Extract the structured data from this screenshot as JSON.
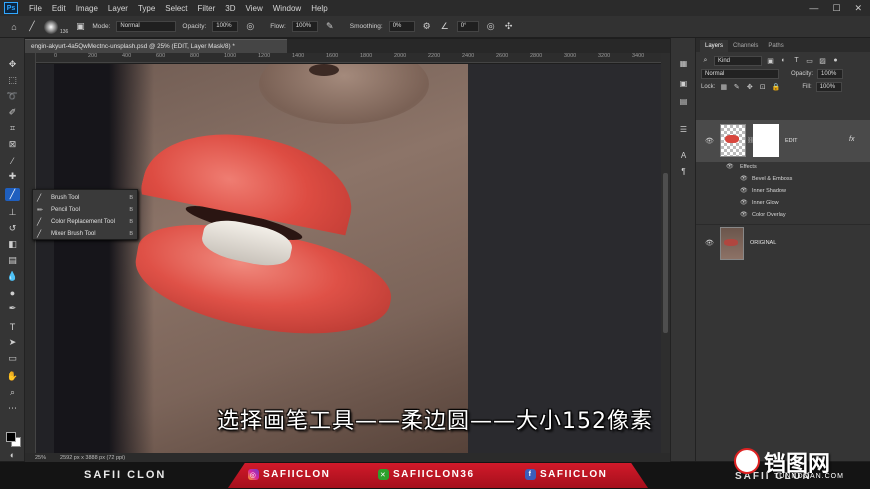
{
  "menubar": {
    "logo": "Ps",
    "items": [
      "File",
      "Edit",
      "Image",
      "Layer",
      "Type",
      "Select",
      "Filter",
      "3D",
      "View",
      "Window",
      "Help"
    ],
    "window_controls": [
      "—",
      "☐",
      "✕"
    ]
  },
  "options": {
    "brush_size": "136",
    "mode_label": "Mode:",
    "mode_value": "Normal",
    "opacity_label": "Opacity:",
    "opacity_value": "100%",
    "flow_label": "Flow:",
    "flow_value": "100%",
    "smoothing_label": "Smoothing:",
    "smoothing_value": "0%",
    "angle_value": "0°"
  },
  "document": {
    "tab_title": "engin-akyurt-4a5QwMectnc-unsplash.psd @ 25% (EDIT, Layer Mask/8) *",
    "ruler_ticks": [
      "0",
      "200",
      "400",
      "600",
      "800",
      "1000",
      "1200",
      "1400",
      "1600",
      "1800",
      "2000",
      "2200",
      "2400",
      "2600",
      "2800",
      "3000",
      "3200",
      "3400"
    ],
    "status_zoom": "25%",
    "status_info": "2592 px x 3888 px (72 ppi)"
  },
  "flyout": {
    "items": [
      {
        "label": "Brush Tool",
        "shortcut": "B"
      },
      {
        "label": "Pencil Tool",
        "shortcut": "B"
      },
      {
        "label": "Color Replacement Tool",
        "shortcut": "B"
      },
      {
        "label": "Mixer Brush Tool",
        "shortcut": "B"
      }
    ]
  },
  "subtitle": "选择画笔工具——柔边圆——大小152像素",
  "layers_panel": {
    "tabs": [
      "Layers",
      "Channels",
      "Paths"
    ],
    "kind_label": "Kind",
    "blend_mode": "Normal",
    "opacity_label": "Opacity:",
    "opacity_value": "100%",
    "lock_label": "Lock:",
    "fill_label": "Fill:",
    "fill_value": "100%",
    "layers": [
      {
        "name": "EDIT",
        "fx": "fx"
      },
      {
        "name": "ORIGINAL"
      }
    ],
    "effects_label": "Effects",
    "effects": [
      "Bevel & Emboss",
      "Inner Shadow",
      "Inner Glow",
      "Color Overlay"
    ]
  },
  "banner": {
    "left": "SAFII CLON",
    "instagram": "SAFIICLON",
    "xbox": "SAFIICLON36",
    "facebook": "SAFIICLON",
    "right": "SAFII CLON"
  },
  "watermark": {
    "text": "铛图网",
    "sub": "TUNNDOAN.COM"
  },
  "colors": {
    "accent": "#1f5fbf",
    "banner_red": "#c3162a"
  }
}
